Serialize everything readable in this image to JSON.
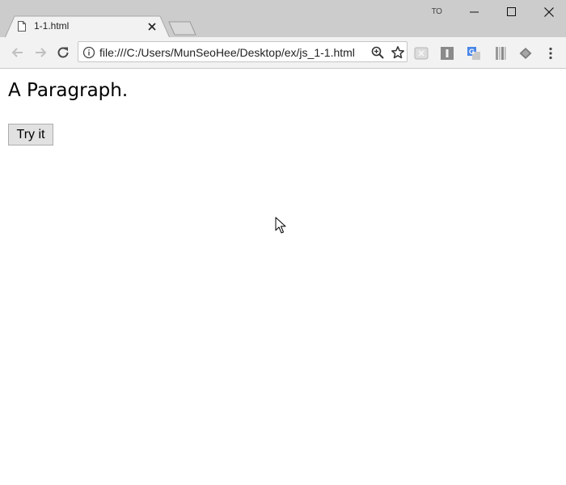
{
  "browser": {
    "tab": {
      "title": "1-1.html"
    },
    "profile_badge": "TO",
    "address_bar": {
      "url": "file:///C:/Users/MunSeoHee/Desktop/ex/js_1-1.html"
    }
  },
  "page": {
    "paragraph_text": "A Paragraph.",
    "button_label": "Try it"
  },
  "icons": {
    "back": "arrow-left-icon",
    "forward": "arrow-right-icon",
    "reload": "reload-icon",
    "info": "info-icon",
    "zoom": "zoom-icon",
    "bookmark": "star-icon",
    "menu": "kebab-menu-icon"
  },
  "colors": {
    "titlebar": "#cccccc",
    "toolbar": "#f2f2f2",
    "button_bg": "#e1e1e1",
    "translate_ext": "#4a86e8"
  }
}
